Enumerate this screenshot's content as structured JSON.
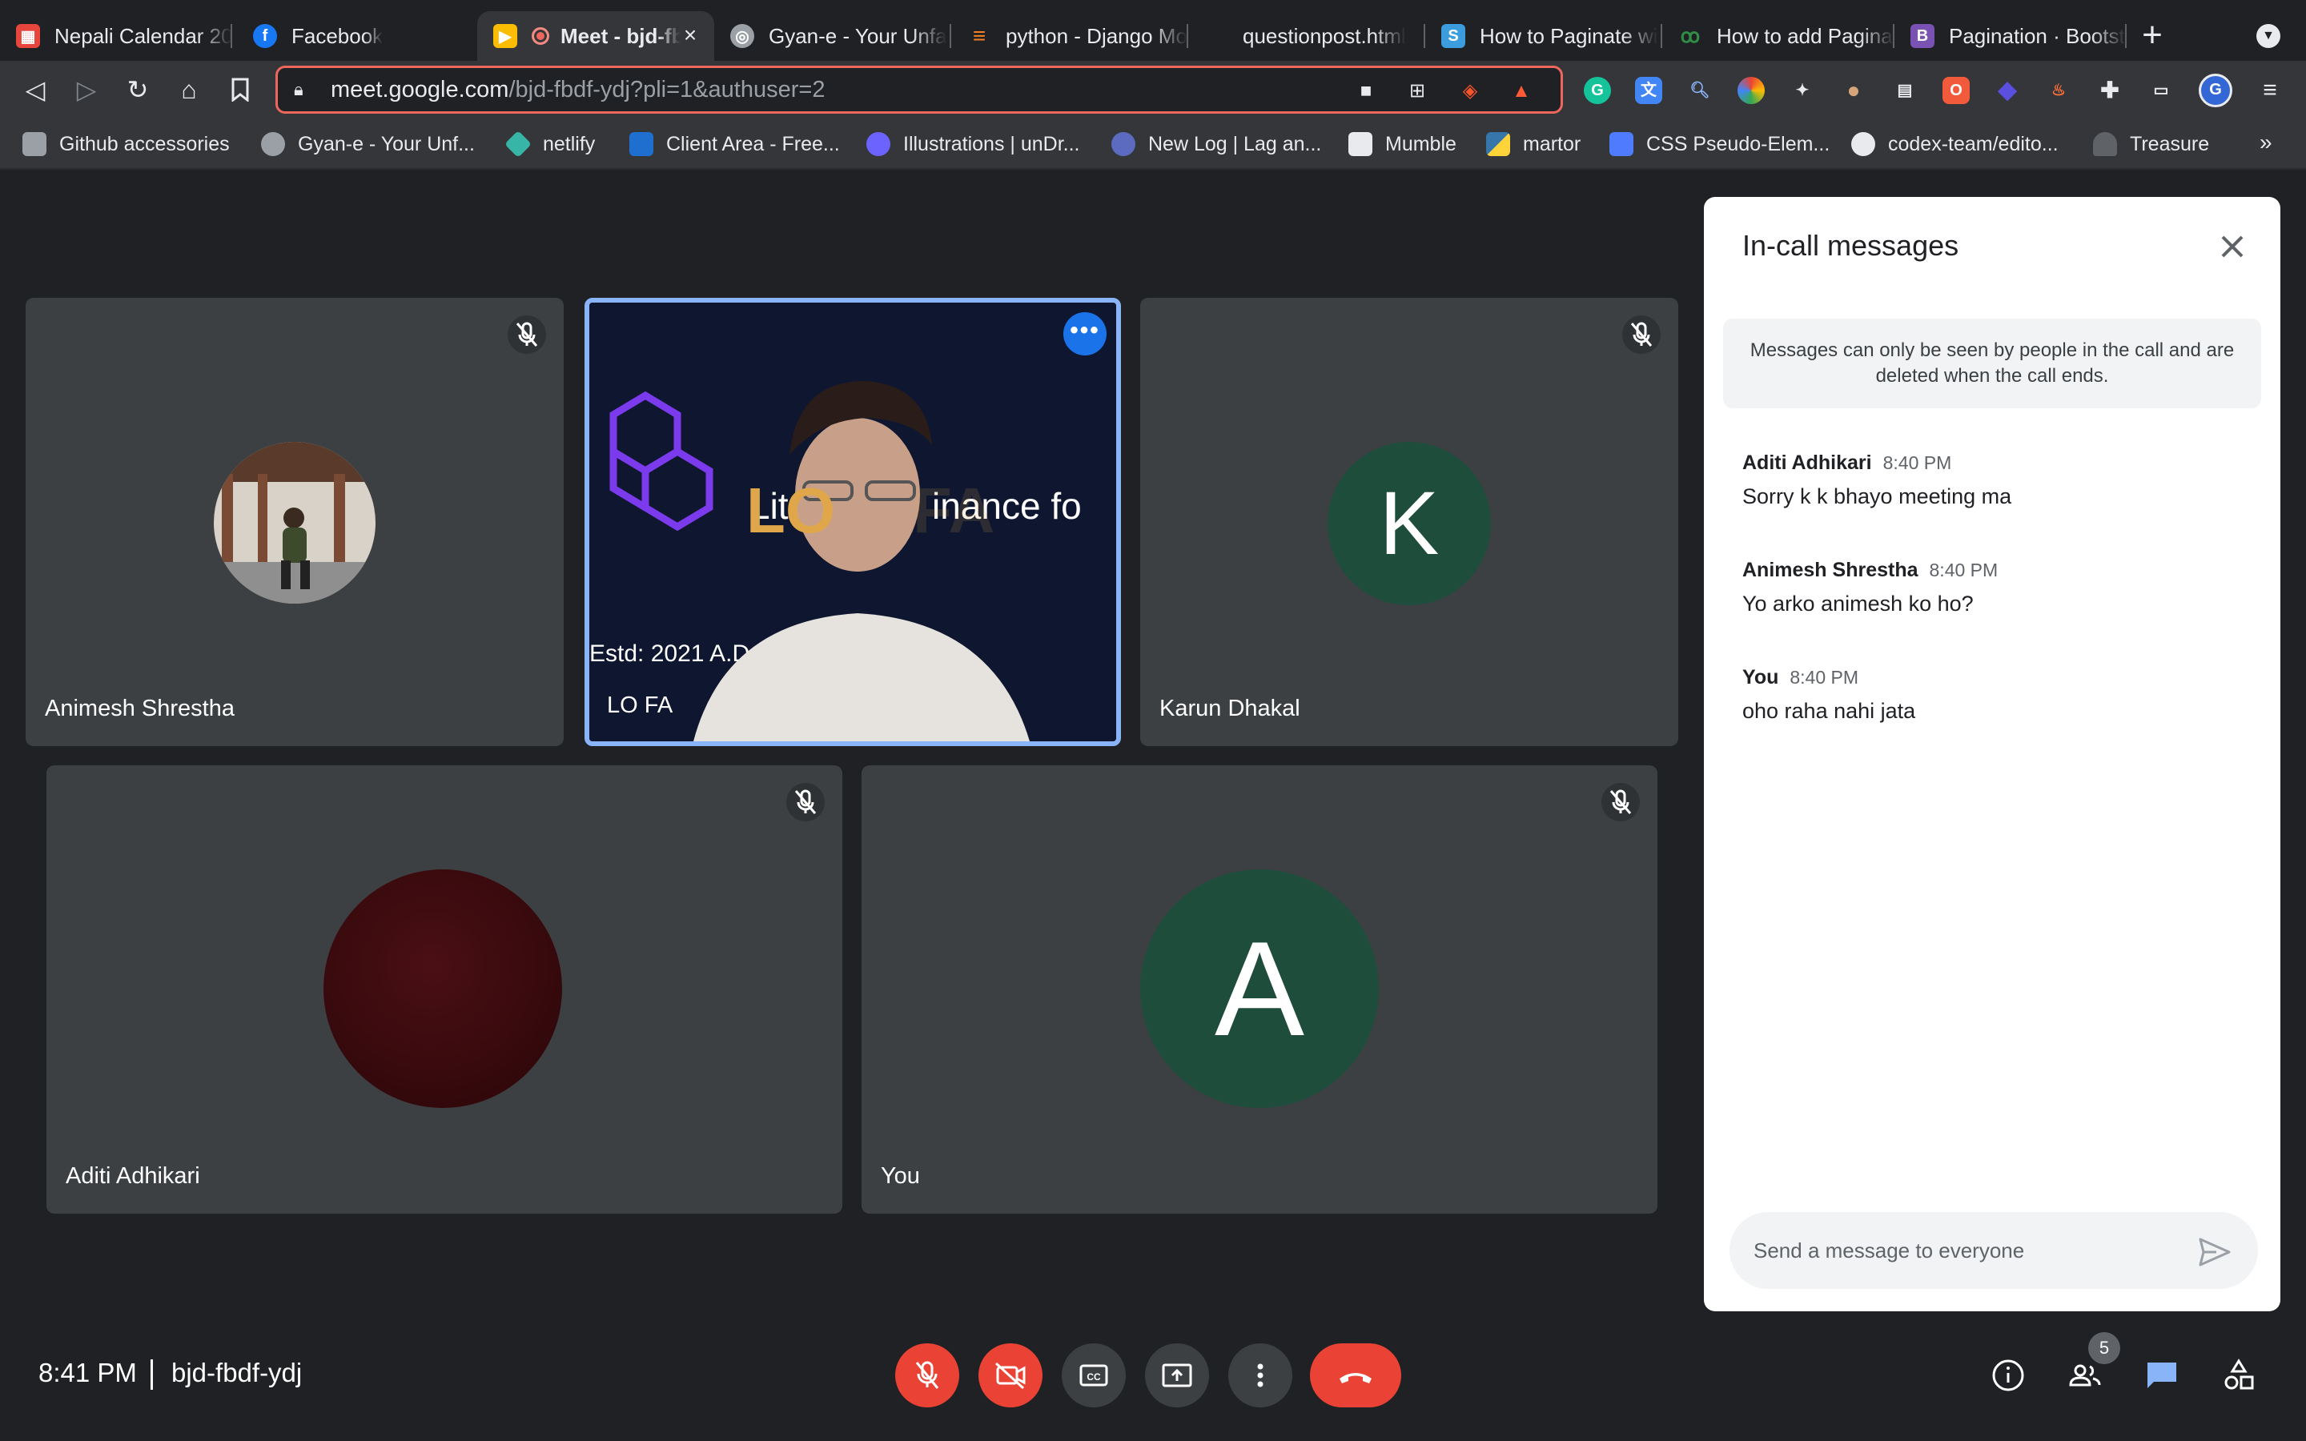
{
  "browser": {
    "tabs": [
      {
        "label": "Nepali Calendar 20",
        "favicon": "calendar-icon",
        "color": "#e8453c"
      },
      {
        "label": "Facebook",
        "favicon": "facebook-icon",
        "color": "#1877f2"
      },
      {
        "label": "Meet - bjd-fb",
        "favicon": "google-meet-icon",
        "color": "#00832d",
        "active": true
      },
      {
        "label": "Gyan-e - Your Unfa",
        "favicon": "globe-icon",
        "color": "#9aa0a6"
      },
      {
        "label": "python - Django Mo",
        "favicon": "stackoverflow-icon",
        "color": "#f48024"
      },
      {
        "label": "questionpost.html",
        "favicon": "github-icon",
        "color": "#202124"
      },
      {
        "label": "How to Paginate wi",
        "favicon": "site-s-icon",
        "color": "#3b9ddd"
      },
      {
        "label": "How to add Paginat",
        "favicon": "geeksforgeeks-icon",
        "color": "#2f8d46"
      },
      {
        "label": "Pagination · Bootstr",
        "favicon": "bootstrap-icon",
        "color": "#7952b3"
      }
    ],
    "url_host": "meet.google.com",
    "url_path": "/bjd-fbdf-ydj?pli=1&authuser=2",
    "bookmarks": [
      {
        "label": "Github accessories",
        "icon": "folder-icon",
        "color": "#9aa0a6"
      },
      {
        "label": "Gyan-e - Your Unf...",
        "icon": "globe-icon",
        "color": "#9aa0a6"
      },
      {
        "label": "netlify",
        "icon": "netlify-icon",
        "color": "#37b5a6"
      },
      {
        "label": "Client Area - Free...",
        "icon": "client-area-icon",
        "color": "#1f6fd1"
      },
      {
        "label": "Illustrations | unDr...",
        "icon": "undraw-icon",
        "color": "#6c63ff"
      },
      {
        "label": "New Log | Lag an...",
        "icon": "log-icon",
        "color": "#5c6bc0"
      },
      {
        "label": "Mumble",
        "icon": "mumble-icon",
        "color": "#e8eaed"
      },
      {
        "label": "martor",
        "icon": "python-icon",
        "color": "#3776ab"
      },
      {
        "label": "CSS Pseudo-Elem...",
        "icon": "flag-icon",
        "color": "#4f7cff"
      },
      {
        "label": "codex-team/edito...",
        "icon": "github-icon",
        "color": "#e8eaed"
      },
      {
        "label": "Treasure",
        "icon": "treasure-icon",
        "color": "#5f6368"
      }
    ]
  },
  "meet": {
    "participants": [
      {
        "name": "Animesh Shrestha",
        "muted": true,
        "avatar": "photo"
      },
      {
        "name": "LO FA",
        "muted": false,
        "presenting": true
      },
      {
        "name": "Karun Dhakal",
        "muted": true,
        "avatar_letter": "K"
      },
      {
        "name": "Aditi Adhikari",
        "muted": true,
        "avatar": "photo"
      },
      {
        "name": "You",
        "muted": true,
        "avatar_letter": "A"
      }
    ],
    "presentation": {
      "logo_text": "LO",
      "logo_text_faded": "FA",
      "tagline_left": "Liter",
      "tagline_right": "inance fo",
      "established": "Estd: 2021 A.D."
    },
    "chat": {
      "title": "In-call messages",
      "notice": "Messages can only be seen by people in the call and are deleted when the call ends.",
      "messages": [
        {
          "sender": "Aditi Adhikari",
          "time": "8:40 PM",
          "text": "Sorry k k bhayo meeting ma"
        },
        {
          "sender": "Animesh Shrestha",
          "time": "8:40 PM",
          "text": "Yo arko animesh ko ho?"
        },
        {
          "sender": "You",
          "time": "8:40 PM",
          "text": "oho raha nahi jata"
        }
      ],
      "input_placeholder": "Send a message to everyone"
    },
    "bottom_bar": {
      "time": "8:41 PM",
      "meeting_code": "bjd-fbdf-ydj",
      "participant_count": "5"
    },
    "colors": {
      "accent": "#1a73e8",
      "danger": "#ea4335",
      "avatar_green": "#1e4d3c",
      "tile_bg": "#3c4043"
    }
  }
}
